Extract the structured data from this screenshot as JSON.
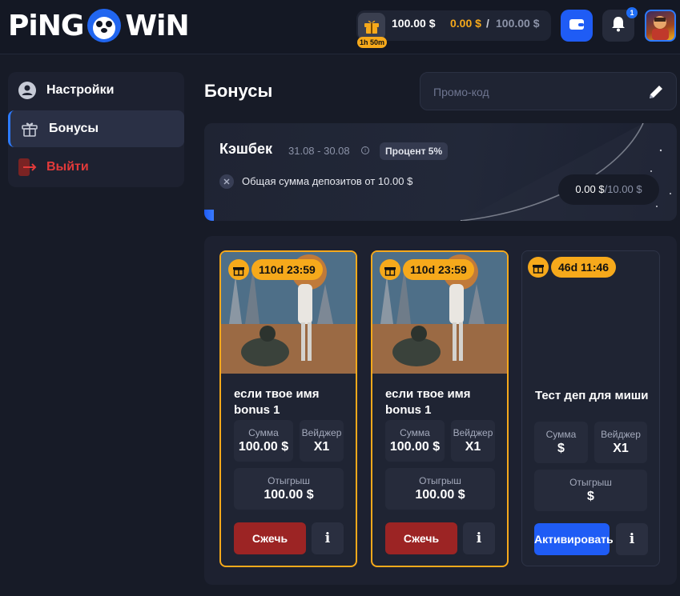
{
  "header": {
    "logo_left": "PiNG",
    "logo_right": "WiN",
    "gift_timer": "1h 50m",
    "balance_main": "100.00 $",
    "balance_bonus": "0.00 $",
    "balance_sep": "/",
    "balance_total": "100.00 $",
    "notification_count": "1",
    "icons": [
      "gift-icon",
      "wallet-icon",
      "bell-icon"
    ]
  },
  "sidebar": {
    "items": [
      {
        "label": "Настройки",
        "icon": "user-icon"
      },
      {
        "label": "Бонусы",
        "icon": "gift-icon",
        "active": true
      },
      {
        "label": "Выйти",
        "icon": "logout-icon"
      }
    ]
  },
  "main": {
    "title": "Бонусы",
    "promo": {
      "placeholder": "Промо-код",
      "value": ""
    }
  },
  "cashback": {
    "title": "Кэшбек",
    "dates": "31.08 - 30.08",
    "percent_badge": "Процент 5%",
    "condition": "Общая сумма депозитов от 10.00 $",
    "progress_current": "0.00 $",
    "progress_target": "/10.00 $",
    "progress_fraction": 0.0
  },
  "bonuses": [
    {
      "timer": "110d 23:59",
      "title": "если твое имя bonus 1",
      "sum_label": "Сумма",
      "sum_value": "100.00 $",
      "wager_label": "Вейджер",
      "wager_value": "X1",
      "winnings_label": "Отыгрыш",
      "winnings_value": "100.00 $",
      "action_label": "Сжечь",
      "info_label": "i"
    },
    {
      "timer": "110d 23:59",
      "title": "если твое имя bonus 1",
      "sum_label": "Сумма",
      "sum_value": "100.00 $",
      "wager_label": "Вейджер",
      "wager_value": "X1",
      "winnings_label": "Отыгрыш",
      "winnings_value": "100.00 $",
      "action_label": "Сжечь",
      "info_label": "i"
    },
    {
      "timer": "46d 11:46",
      "title": "Тест деп для миши",
      "sum_label": "Сумма",
      "sum_value": "$",
      "wager_label": "Вейджер",
      "wager_value": "X1",
      "winnings_label": "Отыгрыш",
      "winnings_value": "$",
      "action_label": "Активировать",
      "info_label": "i"
    }
  ],
  "colors": {
    "accent_blue": "#1f5cf5",
    "accent_orange": "#f6a91b",
    "danger_red": "#9c2424",
    "logout_red": "#e23a3a"
  }
}
